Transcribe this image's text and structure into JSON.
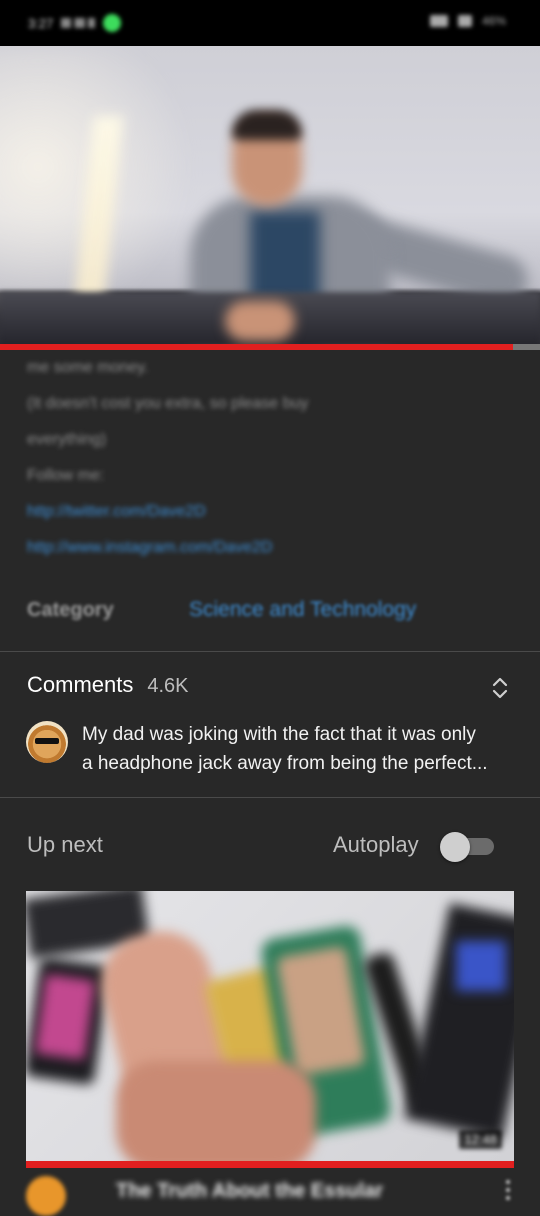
{
  "status_bar": {
    "time": "3:27",
    "battery": "46%"
  },
  "player": {
    "progress": 0.95,
    "accent_color": "#e11f1f"
  },
  "description": {
    "lines": [
      "me some money.",
      "(It doesn't cost you extra, so please buy",
      "everything)",
      "Follow me:"
    ],
    "links": [
      "http://twitter.com/Dave2D",
      "http://www.instagram.com/Dave2D"
    ],
    "category_label": "Category",
    "category_value": "Science and Technology",
    "link_color": "#3e8fd6"
  },
  "comments": {
    "title": "Comments",
    "count": "4.6K",
    "expand_icon": "unfold-more-icon",
    "top_comment_line1": "My dad was joking with the fact that it was only",
    "top_comment_line2": "a headphone jack away from being the perfect..."
  },
  "up_next": {
    "label": "Up next",
    "autoplay_label": "Autoplay",
    "autoplay_on": false,
    "video": {
      "title": "The Truth About the Essular",
      "duration": "12:48",
      "progress": 1.0
    }
  }
}
